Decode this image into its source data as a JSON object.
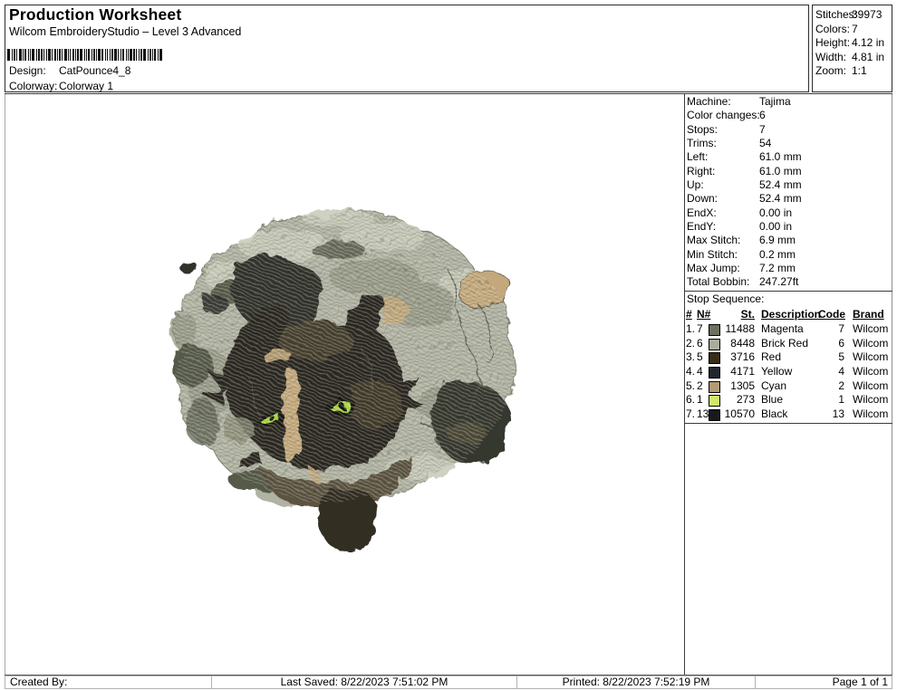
{
  "header": {
    "title": "Production Worksheet",
    "subtitle": "Wilcom EmbroideryStudio – Level 3 Advanced",
    "design_label": "Design:",
    "design_value": "CatPounce4_8",
    "colorway_label": "Colorway:",
    "colorway_value": "Colorway 1",
    "barcode_pattern": [
      3,
      2,
      1,
      1,
      2,
      1,
      1,
      2,
      3,
      1,
      1,
      1,
      2,
      2,
      1,
      1,
      1,
      1,
      3,
      2,
      1,
      1,
      2,
      1,
      2,
      1,
      1,
      2,
      1,
      1,
      3,
      1,
      1,
      2,
      2,
      1,
      1,
      1,
      2,
      1,
      1,
      2,
      3,
      1,
      1,
      1,
      1,
      2,
      2,
      1,
      1,
      1,
      2,
      1,
      3,
      2,
      1,
      1,
      1,
      1,
      2,
      2,
      1,
      1,
      2,
      1,
      1,
      1,
      3,
      1,
      2,
      2,
      1,
      1,
      1,
      2,
      1,
      1,
      2,
      1,
      3,
      1,
      1,
      2,
      1,
      1,
      2,
      2,
      1,
      1,
      1,
      1,
      3,
      1,
      2,
      1,
      1,
      2,
      1,
      1,
      2,
      1,
      3,
      2,
      1,
      1,
      2,
      1,
      1,
      1,
      2,
      2,
      1,
      1,
      3,
      1
    ]
  },
  "stats": {
    "rows": [
      {
        "label": "Stitches:",
        "value": "39973"
      },
      {
        "label": "Colors:",
        "value": "7"
      },
      {
        "label": "Height:",
        "value": "4.12 in"
      },
      {
        "label": "Width:",
        "value": "4.81 in"
      },
      {
        "label": "Zoom:",
        "value": "1:1"
      }
    ]
  },
  "machine_info": {
    "rows": [
      {
        "label": "Machine:",
        "value": "Tajima"
      },
      {
        "label": "Color changes:",
        "value": "6"
      },
      {
        "label": "Stops:",
        "value": "7"
      },
      {
        "label": "Trims:",
        "value": "54"
      },
      {
        "label": "Left:",
        "value": "61.0 mm"
      },
      {
        "label": "Right:",
        "value": "61.0 mm"
      },
      {
        "label": "Up:",
        "value": "52.4 mm"
      },
      {
        "label": "Down:",
        "value": "52.4 mm"
      },
      {
        "label": "EndX:",
        "value": "0.00 in"
      },
      {
        "label": "EndY:",
        "value": "0.00 in"
      },
      {
        "label": "Max Stitch:",
        "value": "6.9 mm"
      },
      {
        "label": "Min Stitch:",
        "value": "0.2 mm"
      },
      {
        "label": "Max Jump:",
        "value": "7.2 mm"
      },
      {
        "label": "Total Bobbin:",
        "value": "247.27ft"
      }
    ]
  },
  "stop_sequence": {
    "title": "Stop Sequence:",
    "columns": {
      "num": "#",
      "needle": "N#",
      "stitches": "St.",
      "description": "Description",
      "code": "Code",
      "brand": "Brand"
    },
    "rows": [
      {
        "num": "1.",
        "needle": "7",
        "swatch": "#6e7060",
        "st": "11488",
        "description": "Magenta",
        "code": "7",
        "brand": "Wilcom"
      },
      {
        "num": "2.",
        "needle": "6",
        "swatch": "#a9ab9b",
        "st": "8448",
        "description": "Brick Red",
        "code": "6",
        "brand": "Wilcom"
      },
      {
        "num": "3.",
        "needle": "5",
        "swatch": "#372d17",
        "st": "3716",
        "description": "Red",
        "code": "5",
        "brand": "Wilcom"
      },
      {
        "num": "4.",
        "needle": "4",
        "swatch": "#23262b",
        "st": "4171",
        "description": "Yellow",
        "code": "4",
        "brand": "Wilcom"
      },
      {
        "num": "5.",
        "needle": "2",
        "swatch": "#b29a74",
        "st": "1305",
        "description": "Cyan",
        "code": "2",
        "brand": "Wilcom"
      },
      {
        "num": "6.",
        "needle": "1",
        "swatch": "#cdeb66",
        "st": "273",
        "description": "Blue",
        "code": "1",
        "brand": "Wilcom"
      },
      {
        "num": "7.",
        "needle": "13",
        "swatch": "#17191d",
        "st": "10570",
        "description": "Black",
        "code": "13",
        "brand": "Wilcom"
      }
    ]
  },
  "footer": {
    "created_by": "Created By:",
    "last_saved": "Last Saved: 8/22/2023 7:51:02 PM",
    "printed": "Printed: 8/22/2023 7:52:19 PM",
    "page": "Page 1 of 1"
  },
  "design_preview": {
    "palette": {
      "base": "#afb1a0",
      "light": "#c7c9b8",
      "mid": "#8f927e",
      "olive": "#565a48",
      "charcoal": "#30322b",
      "tan": "#c2a87b",
      "face_dark": "#2b2820",
      "face_brown": "#4a4231",
      "chest_brown": "#5b5340",
      "eye_green": "#a8d542",
      "paw_dark": "#332d23"
    }
  }
}
